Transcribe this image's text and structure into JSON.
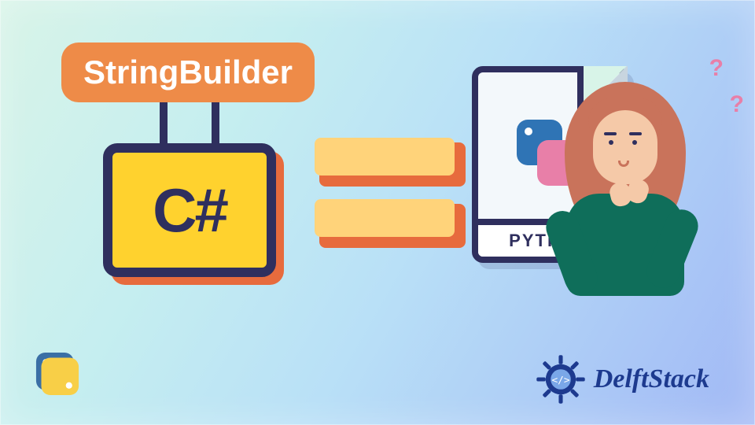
{
  "badge": {
    "label": "StringBuilder"
  },
  "sign": {
    "lang": "C#"
  },
  "file": {
    "caption": "PYTHON"
  },
  "q1": "?",
  "q2": "?",
  "brand": {
    "name": "DelftStack"
  }
}
